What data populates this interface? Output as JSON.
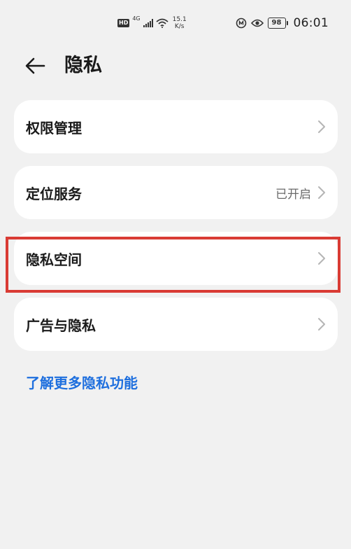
{
  "status_bar": {
    "hd_badge": "HD",
    "network_badge": "4G",
    "speed_value": "15.1",
    "speed_unit": "K/s",
    "battery_level": "98",
    "time": "06:01",
    "icons": [
      "hd-icon",
      "signal-icon",
      "wifi-icon",
      "speed-indicator",
      "nfc-icon",
      "eye-comfort-icon",
      "battery-icon"
    ]
  },
  "header": {
    "title": "隐私",
    "back_icon": "arrow-left-icon"
  },
  "menu": {
    "items": [
      {
        "label": "权限管理",
        "value": ""
      },
      {
        "label": "定位服务",
        "value": "已开启"
      },
      {
        "label": "隐私空间",
        "value": ""
      },
      {
        "label": "广告与隐私",
        "value": ""
      }
    ]
  },
  "learn_more": "了解更多隐私功能",
  "colors": {
    "background": "#f1f1f1",
    "card": "#ffffff",
    "link": "#1e6fde",
    "highlight": "#d93b34"
  }
}
